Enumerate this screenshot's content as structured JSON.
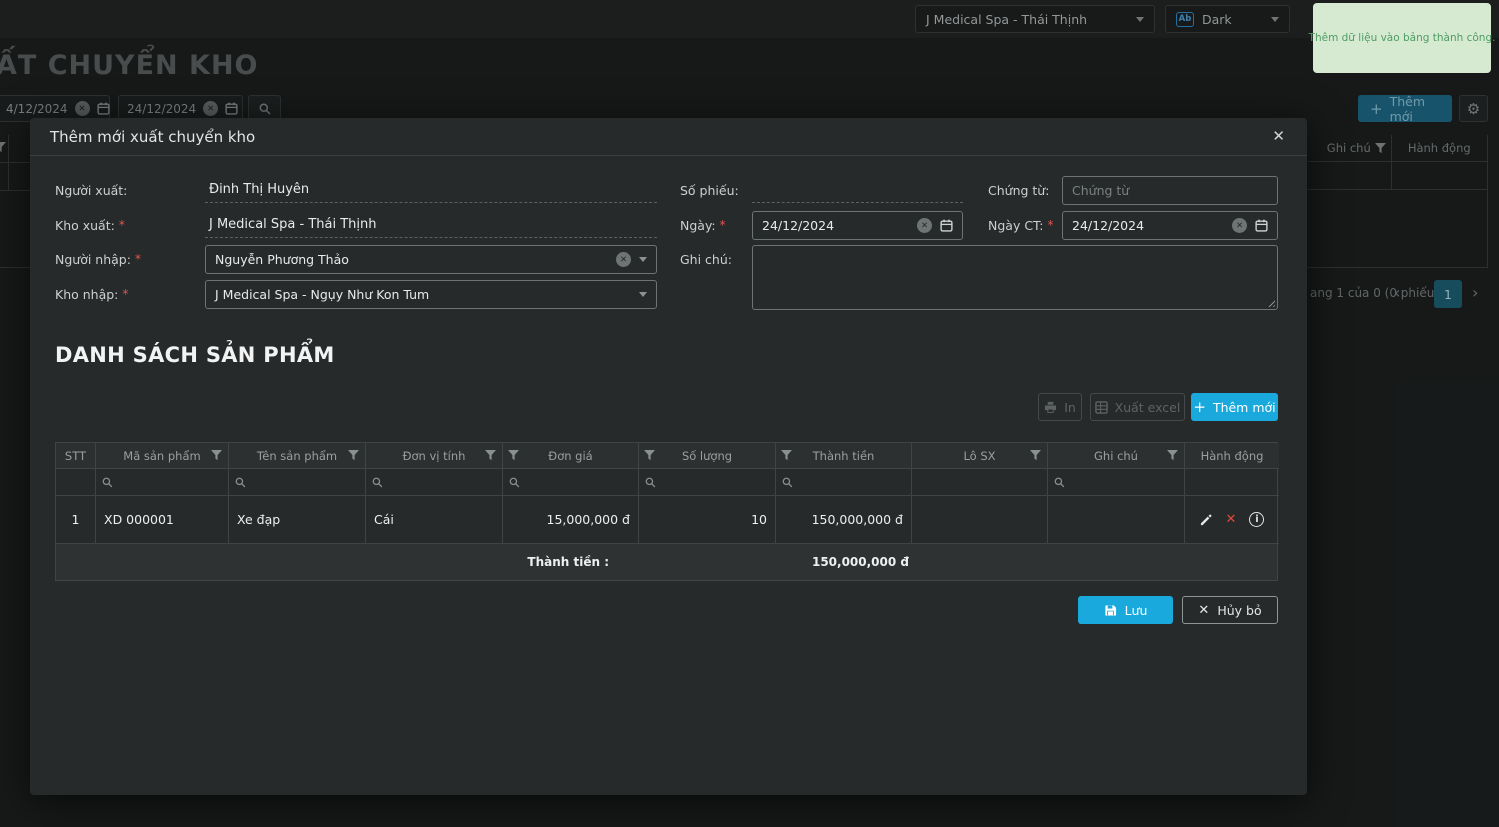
{
  "colors": {
    "accent": "#19a9dd",
    "danger": "#e0483e",
    "toast_bg": "#d6ead2",
    "toast_text": "#4f9c63",
    "teal_dim": "#1d6a88",
    "modal_bg": "#272a2a"
  },
  "icons": {
    "caret_down": "css-triangle-down",
    "clear_circle": "✕",
    "close": "✕",
    "gear": "⚙",
    "plus": "+",
    "chevron_left": "‹",
    "chevron_right": "›",
    "delete_cross": "✕",
    "info": "i",
    "calendar": "svg-calendar",
    "search": "svg-magnifier",
    "filter": "svg-funnel",
    "print": "svg-printer",
    "excel": "svg-table",
    "save": "svg-floppy",
    "edit": "svg-pencil"
  },
  "topbar": {
    "clinic": "J Medical Spa - Thái Thịnh",
    "theme": "Dark",
    "theme_icon_label": "Ab"
  },
  "toast": {
    "message": "Thêm dữ liệu vào bảng thành công."
  },
  "page": {
    "title": "ẤT CHUYỂN KHO",
    "filter": {
      "date_from": "4/12/2024",
      "date_to": "24/12/2024"
    },
    "add_new": "Thêm mới",
    "bg_table": {
      "col_ghichu": "Ghi chú",
      "col_hanhdong": "Hành động"
    },
    "pagination": {
      "info": "ang 1 của 0 (0 phiếu)",
      "prev": "‹",
      "page": "1",
      "next": "›"
    }
  },
  "modal": {
    "title": "Thêm mới xuất chuyển kho",
    "close": "✕",
    "required_mark": "*",
    "fields": {
      "nguoi_xuat": {
        "label": "Người xuất:",
        "value": "Đinh Thị Huyên"
      },
      "kho_xuat": {
        "label": "Kho xuất:",
        "value": "J Medical Spa - Thái Thịnh"
      },
      "nguoi_nhap": {
        "label": "Người nhập:",
        "value": "Nguyễn Phương Thảo"
      },
      "kho_nhap": {
        "label": "Kho nhập:",
        "value": "J Medical Spa - Ngụy Như Kon Tum"
      },
      "so_phieu": {
        "label": "Số phiếu:",
        "value": ""
      },
      "chung_tu": {
        "label": "Chứng từ:",
        "placeholder": "Chứng từ"
      },
      "ngay": {
        "label": "Ngày:",
        "value": "24/12/2024"
      },
      "ngay_ct": {
        "label": "Ngày CT:",
        "value": "24/12/2024"
      },
      "ghi_chu": {
        "label": "Ghi chú:",
        "value": ""
      }
    },
    "products": {
      "heading": "DANH SÁCH SẢN PHẨM",
      "toolbar": {
        "print": "In",
        "export": "Xuất excel",
        "add": "Thêm mới"
      },
      "table": {
        "columns": [
          "STT",
          "Mã sản phẩm",
          "Tên sản phẩm",
          "Đơn vị tính",
          "Đơn giá",
          "Số lượng",
          "Thành tiền",
          "Lô SX",
          "Ghi chú",
          "Hành động"
        ],
        "rows": [
          {
            "stt": "1",
            "ma": "XD 000001",
            "ten": "Xe đạp",
            "dvt": "Cái",
            "don_gia": "15,000,000 đ",
            "so_luong": "10",
            "thanh_tien": "150,000,000 đ",
            "lo_sx": "",
            "ghi_chu": ""
          }
        ],
        "footer": {
          "label": "Thành tiền :",
          "total": "150,000,000 đ"
        }
      }
    },
    "actions": {
      "save": "Lưu",
      "cancel": "Hủy bỏ"
    }
  }
}
